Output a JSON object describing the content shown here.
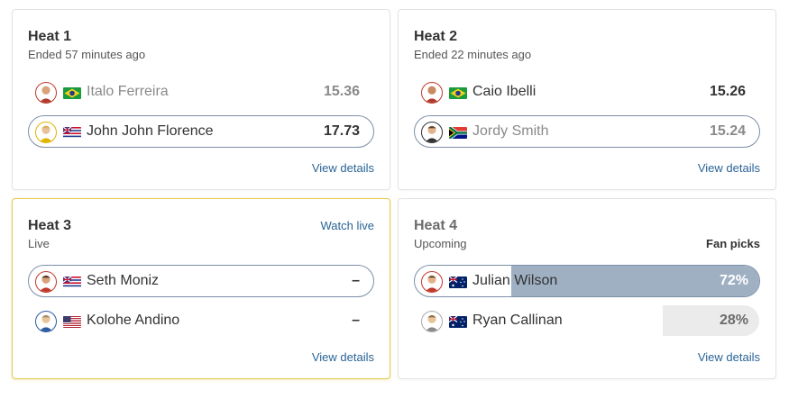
{
  "heats": [
    {
      "title": "Heat 1",
      "status": "Ended 57 minutes ago",
      "details_label": "View details",
      "surfers": [
        {
          "name": "Italo Ferreira",
          "score": "15.36",
          "country": "Brazil",
          "avatar_ring": "#c0392b"
        },
        {
          "name": "John John Florence",
          "score": "17.73",
          "country": "Hawaii",
          "avatar_ring": "#e0b400"
        }
      ]
    },
    {
      "title": "Heat 2",
      "status": "Ended 22 minutes ago",
      "details_label": "View details",
      "surfers": [
        {
          "name": "Caio Ibelli",
          "score": "15.26",
          "country": "Brazil",
          "avatar_ring": "#c0392b"
        },
        {
          "name": "Jordy Smith",
          "score": "15.24",
          "country": "South Africa",
          "avatar_ring": "#333333"
        }
      ]
    },
    {
      "title": "Heat 3",
      "status": "Live",
      "action_label": "Watch live",
      "details_label": "View details",
      "surfers": [
        {
          "name": "Seth Moniz",
          "score": "–",
          "country": "Hawaii",
          "avatar_ring": "#c0392b"
        },
        {
          "name": "Kolohe Andino",
          "score": "–",
          "country": "USA",
          "avatar_ring": "#2c5aa0"
        }
      ]
    },
    {
      "title": "Heat 4",
      "status": "Upcoming",
      "fan_picks_label": "Fan picks",
      "details_label": "View details",
      "surfers": [
        {
          "name": "Julian Wilson",
          "pct": "72%",
          "pick_fraction": 0.72,
          "country": "Australia",
          "avatar_ring": "#c0392b"
        },
        {
          "name": "Ryan Callinan",
          "pct": "28%",
          "pick_fraction": 0.28,
          "country": "Australia",
          "avatar_ring": "#aaaaaa"
        }
      ]
    }
  ],
  "colors": {
    "link": "#2a6496",
    "live_border": "#e5c94a",
    "winner_outline": "#7c8fa6",
    "fan_pick_leader": "#9fb0c3",
    "fan_pick_other": "#ebebeb"
  }
}
